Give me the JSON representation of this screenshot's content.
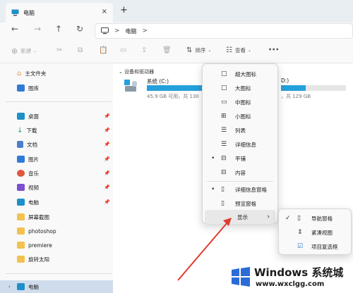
{
  "tab": {
    "title": "电脑",
    "close_icon": "×",
    "new_tab_icon": "+"
  },
  "nav": {
    "back": "←",
    "forward": "→",
    "up": "↑",
    "refresh": "↻"
  },
  "address": {
    "crumb": "电脑",
    "chevron": ">"
  },
  "toolbar": {
    "new_label": "新建",
    "sort_label": "排序",
    "view_label": "查看",
    "more": "•••"
  },
  "sidebar": {
    "top_items": [
      {
        "label": "主文件夹",
        "icon": "home-icon"
      },
      {
        "label": "图库",
        "icon": "gallery-icon"
      }
    ],
    "pinned_items": [
      {
        "label": "桌面",
        "icon": "desktop-icon",
        "color": "#1e90c9"
      },
      {
        "label": "下载",
        "icon": "download-icon",
        "color": "#2e9e5b"
      },
      {
        "label": "文档",
        "icon": "documents-icon",
        "color": "#4a7fcf"
      },
      {
        "label": "图片",
        "icon": "pictures-icon",
        "color": "#2f7bd8"
      },
      {
        "label": "音乐",
        "icon": "music-icon",
        "color": "#e0573e"
      },
      {
        "label": "视频",
        "icon": "video-icon",
        "color": "#7b4fd0"
      },
      {
        "label": "电脑",
        "icon": "computer-icon",
        "color": "#1e90c9"
      },
      {
        "label": "屏幕截图",
        "icon": "folder-icon",
        "color": "#f2c14e"
      },
      {
        "label": "photoshop",
        "icon": "folder-icon",
        "color": "#f2c14e"
      },
      {
        "label": "premiere",
        "icon": "folder-icon",
        "color": "#f2c14e"
      },
      {
        "label": "旋转太阳",
        "icon": "folder-icon",
        "color": "#f2c14e"
      }
    ],
    "selected": {
      "label": "电脑",
      "icon": "computer-icon"
    }
  },
  "content": {
    "group_header": "设备和驱动器",
    "drives": [
      {
        "name": "系统 (C:)",
        "used_fraction": 0.65,
        "sub": "45.9 GB 可用，共 130"
      },
      {
        "name": "D:)",
        "used_fraction": 0.38,
        "sub": "，共 129 GB"
      }
    ]
  },
  "view_menu": {
    "items": [
      {
        "label": "超大图标",
        "icon": "□",
        "bullet": ""
      },
      {
        "label": "大图标",
        "icon": "□",
        "bullet": ""
      },
      {
        "label": "中图标",
        "icon": "▭",
        "bullet": ""
      },
      {
        "label": "小图标",
        "icon": "⊞",
        "bullet": ""
      },
      {
        "label": "列表",
        "icon": "☰",
        "bullet": ""
      },
      {
        "label": "详细信息",
        "icon": "☰",
        "bullet": ""
      },
      {
        "label": "平铺",
        "icon": "⊟",
        "bullet": "•"
      },
      {
        "label": "内容",
        "icon": "⊟",
        "bullet": ""
      },
      {
        "label": "详细信息窗格",
        "icon": "▯",
        "bullet": "•"
      },
      {
        "label": "预览窗格",
        "icon": "▯",
        "bullet": ""
      },
      {
        "label": "显示",
        "icon": "",
        "bullet": "",
        "submenu": "›"
      }
    ]
  },
  "show_submenu": {
    "items": [
      {
        "label": "导航窗格",
        "icon": "▯",
        "check": "✓"
      },
      {
        "label": "紧凑视图",
        "icon": "⇕",
        "check": ""
      },
      {
        "label": "项目复选框",
        "icon": "☑",
        "check": ""
      }
    ]
  },
  "watermark": {
    "title": "Windows 系统城",
    "url": "www.wxclgg.com"
  },
  "colors": {
    "accent": "#26a0da",
    "arrow": "#e23b2e",
    "selected_bg": "#cfdcec"
  }
}
